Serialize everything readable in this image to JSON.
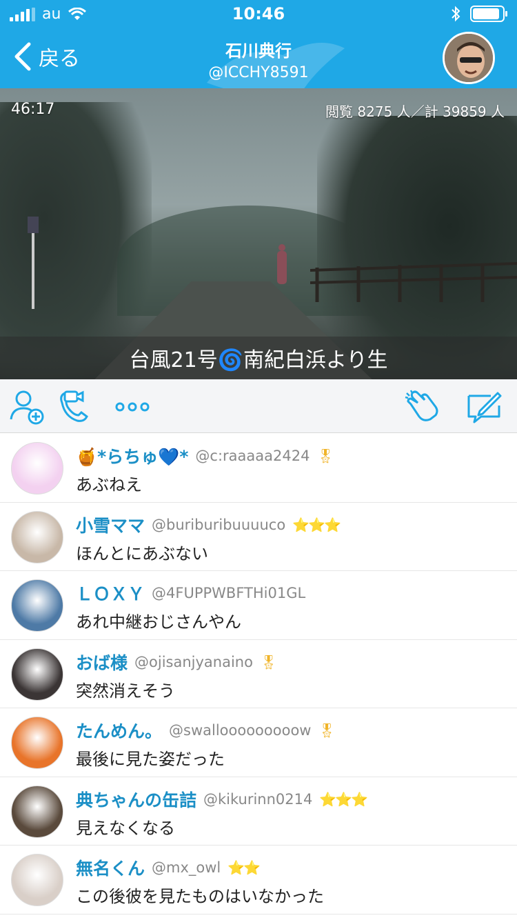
{
  "status": {
    "carrier": "au",
    "time": "10:46",
    "battery_level": 0.9
  },
  "header": {
    "back_label": "戻る",
    "owner_name": "石川典行",
    "owner_handle": "@ICCHY8591"
  },
  "video": {
    "elapsed": "46:17",
    "viewers": "閲覧 8275 人／計 39859 人",
    "caption": "台風21号🌀南紀白浜より生"
  },
  "toolbar": {
    "icons": [
      "add-user-icon",
      "video-call-icon",
      "more-icon",
      "clap-icon",
      "compose-icon"
    ]
  },
  "comments": [
    {
      "name": "🍯*らちゅ💙*",
      "handle": "@c:raaaaa2424",
      "medals": "🎖",
      "text": "あぶねえ",
      "avatar_color": "#f3d1f0"
    },
    {
      "name": "小雪ママ",
      "handle": "@buriburibuuuuco",
      "medals": "⭐⭐⭐",
      "text": "ほんとにあぶない",
      "avatar_color": "#c8b8a8"
    },
    {
      "name": "ＬＯＸＹ",
      "handle": "@4FUPPWBFTHi01GL",
      "medals": "",
      "text": "あれ中継おじさんやん",
      "avatar_color": "#4e7aa6"
    },
    {
      "name": "おば様",
      "handle": "@ojisanjyanaino",
      "medals": "🎖",
      "text": "突然消えそう",
      "avatar_color": "#3b3535"
    },
    {
      "name": "たんめん。",
      "handle": "@swallooooooooow",
      "medals": "🎖",
      "text": "最後に見た姿だった",
      "avatar_color": "#e8742a"
    },
    {
      "name": "典ちゃんの缶詰",
      "handle": "@kikurinn0214",
      "medals": "⭐⭐⭐",
      "text": "見えなくなる",
      "avatar_color": "#5a4a3c"
    },
    {
      "name": "無名くん",
      "handle": "@mx_owl",
      "medals": "⭐⭐",
      "text": "この後彼を見たものはいなかった",
      "avatar_color": "#d9cfc8"
    }
  ]
}
